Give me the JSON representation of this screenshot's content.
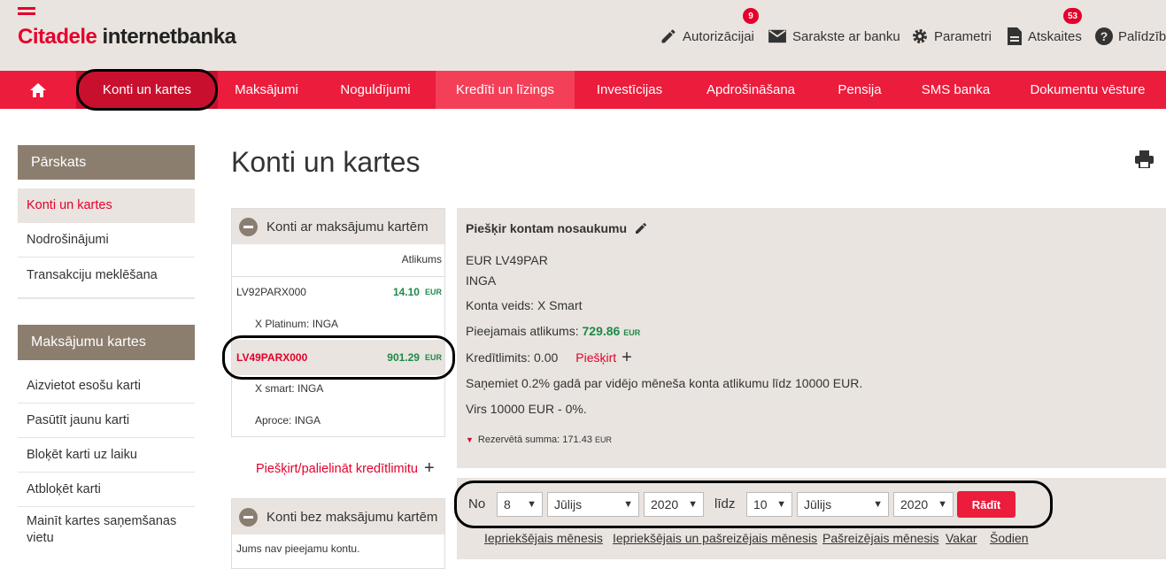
{
  "brand": {
    "name_red": "Citadele",
    "name_dark": " internetbanka"
  },
  "toolbar": [
    {
      "label": "Autorizācijai",
      "icon": "pencil-icon",
      "badge": "9"
    },
    {
      "label": "Sarakste ar banku",
      "icon": "envelope-icon"
    },
    {
      "label": "Parametri",
      "icon": "gear-icon"
    },
    {
      "label": "Atskaites",
      "icon": "document-icon",
      "badge": "53"
    },
    {
      "label": "Palīdzība",
      "icon": "help-icon"
    }
  ],
  "nav": {
    "home_icon": "home-icon",
    "items": [
      "Konti un kartes",
      "Maksājumi",
      "Noguldījumi",
      "Kredīti un līzings",
      "Investīcijas",
      "Apdrošināšana",
      "Pensija",
      "SMS banka",
      "Dokumentu vēsture"
    ]
  },
  "sidebar": {
    "overview": {
      "title": "Pārskats",
      "items": [
        "Konti un kartes",
        "Nodrošinājumi",
        "Transakciju meklēšana"
      ]
    },
    "cards": {
      "title": "Maksājumu kartes",
      "items": [
        "Aizvietot esošu karti",
        "Pasūtīt jaunu karti",
        "Bloķēt karti uz laiku",
        "Atbloķēt karti",
        "Mainīt kartes saņemšanas vietu"
      ]
    }
  },
  "page_title": "Konti un kartes",
  "accounts_panel": {
    "title": "Konti ar maksājumu kartēm",
    "col_balance": "Atlikums",
    "accounts": [
      {
        "id": "LV92PARX000",
        "amount": "14.10",
        "currency": "EUR",
        "card": "X Platinum: INGA"
      },
      {
        "id": "LV49PARX000",
        "amount": "901.29",
        "currency": "EUR",
        "cards": [
          "X smart: INGA",
          "Aproce: INGA"
        ]
      }
    ],
    "credit_link": "Piešķirt/palielināt kredītlimitu"
  },
  "no_cards_panel": {
    "title": "Konti bez maksājumu kartēm",
    "message": "Jums nav pieejamu kontu."
  },
  "detail": {
    "name_prompt": "Piešķir kontam nosaukumu",
    "account": "EUR LV49PAR",
    "owner": "INGA",
    "type": "Konta veids: X Smart",
    "available_label": "Pieejamais atlikums:",
    "available_amount": "729.86",
    "available_currency": "EUR",
    "credit_limit": "Kredītlimits: 0.00",
    "credit_assign": "Piešķirt",
    "promo": "Saņemiet 0.2% gadā par vidējo mēneša konta atlikumu līdz 10000 EUR.",
    "promo2": "Virs 10000 EUR - 0%.",
    "reserved": "Rezervētā summa: 171.43",
    "reserved_currency": "EUR"
  },
  "filter": {
    "from_label": "No",
    "to_label": "līdz",
    "from_day": "8",
    "from_month": "Jūlijs",
    "from_year": "2020",
    "to_day": "10",
    "to_month": "Jūlijs",
    "to_year": "2020",
    "show_button": "Rādīt",
    "links": [
      "Iepriekšējais mēnesis",
      "Iepriekšējais un pašreizējais mēnesis",
      "Pašreizējais mēnesis",
      "Vakar",
      "Šodien"
    ]
  },
  "colors": {
    "brand_red": "#e4002b",
    "nav_red": "#ec1c3c",
    "beige": "#e9e4df",
    "taupe": "#8c7e6e",
    "green": "#1d8a4a"
  }
}
